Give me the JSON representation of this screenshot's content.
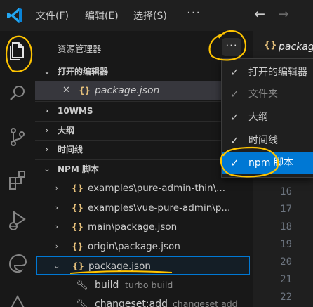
{
  "menubar": {
    "file": "文件(F)",
    "edit": "编辑(E)",
    "selection": "选择(S)",
    "more": "···",
    "back": "←",
    "forward": "→"
  },
  "explorer": {
    "title": "资源管理器",
    "more_button": "···",
    "open_editors": {
      "header": "打开的编辑器",
      "items": [
        {
          "close": "✕",
          "icon": "{}",
          "label": "package.json"
        }
      ]
    },
    "sections": {
      "wms": "10WMS",
      "outline": "大纲",
      "timeline": "时间线"
    },
    "npm_scripts": {
      "header": "NPM 脚本",
      "items": [
        {
          "icon": "{}",
          "label": "examples\\pure-admin-thin\\..."
        },
        {
          "icon": "{}",
          "label": "examples\\vue-pure-admin\\p..."
        },
        {
          "icon": "{}",
          "label": "main\\package.json"
        },
        {
          "icon": "{}",
          "label": "origin\\package.json"
        },
        {
          "icon": "{}",
          "label": "package.json"
        }
      ],
      "scripts": [
        {
          "name": "build",
          "command": "turbo build"
        },
        {
          "name": "changeset:add",
          "command": "changeset add"
        }
      ]
    }
  },
  "dropdown": {
    "items": [
      {
        "check": "✓",
        "label": "打开的编辑器"
      },
      {
        "check": "✓",
        "label": "文件夹"
      },
      {
        "check": "✓",
        "label": "大纲"
      },
      {
        "check": "✓",
        "label": "时间线"
      },
      {
        "check": "✓",
        "label": "npm 脚本"
      }
    ]
  },
  "editor": {
    "tab_icon": "{}",
    "tab_label": "package",
    "line_numbers": [
      "16",
      "17",
      "18",
      "19",
      "20",
      "21",
      "22"
    ]
  },
  "colors": {
    "accent": "#0078d4",
    "json_icon": "#e5c07b",
    "annotation": "#ffc400"
  }
}
